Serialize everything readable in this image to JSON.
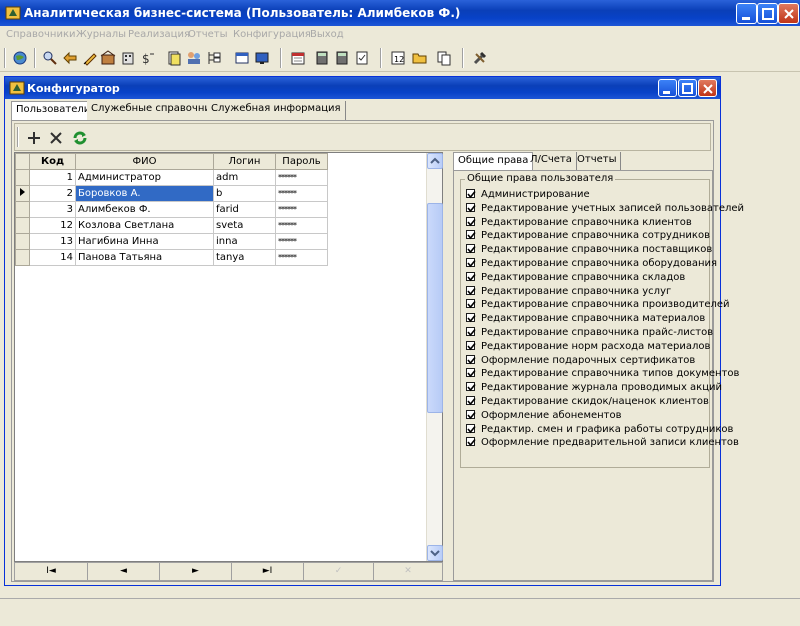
{
  "app": {
    "title": "Аналитическая бизнес-система  (Пользователь: Алимбеков Ф.)"
  },
  "menu": [
    "Справочники",
    "Журналы",
    "Реализация",
    "Отчеты",
    "Конфигурация",
    "Выход"
  ],
  "child": {
    "title": "Конфигуратор",
    "tabs": [
      "Пользователи",
      "Служебные справочники",
      "Служебная информация"
    ],
    "active_tab": "Пользователи"
  },
  "grid": {
    "columns": [
      "Код",
      "ФИО",
      "Логин",
      "Пароль"
    ],
    "rows": [
      {
        "code": "1",
        "fio": "Администратор",
        "login": "adm",
        "password": "******"
      },
      {
        "code": "2",
        "fio": "Боровков А.",
        "login": "b",
        "password": "******"
      },
      {
        "code": "3",
        "fio": "Алимбеков Ф.",
        "login": "farid",
        "password": "******"
      },
      {
        "code": "12",
        "fio": "Козлова Светлана",
        "login": "sveta",
        "password": "******"
      },
      {
        "code": "13",
        "fio": "Нагибина Инна",
        "login": "inna",
        "password": "******"
      },
      {
        "code": "14",
        "fio": "Панова Татьяна",
        "login": "tanya",
        "password": "******"
      }
    ],
    "selected_row": 1
  },
  "navigator": {
    "first": "I◄",
    "prev": "◄",
    "next": "►",
    "last": "►I",
    "post": "✓",
    "cancel": "✕"
  },
  "rights": {
    "tabs": [
      "Общие права",
      "Л/Счета",
      "Отчеты"
    ],
    "group_title": "Общие права пользователя",
    "items": [
      "Администрирование",
      "Редактирование учетных записей пользователей",
      "Редактирование справочника клиентов",
      "Редактирование справочника сотрудников",
      "Редактирование справочника поставщиков",
      "Редактирование справочника оборудования",
      "Редактирование справочника складов",
      "Редактирование справочника услуг",
      "Редактирование справочника производителей",
      "Редактирование справочника материалов",
      "Редактирование справочника прайс-листов",
      "Редактирование норм расхода материалов",
      "Оформление подарочных сертификатов",
      "Редактирование справочника типов документов",
      "Редактирование журнала  проводимых акций",
      "Редактирование скидок/наценок клиентов",
      "Оформление абонементов",
      "Редактир. смен и графика работы сотрудников",
      "Оформление предварительной записи клиентов"
    ]
  },
  "colors": {
    "titlebar": "#0a3fb8",
    "selection": "#316ac5",
    "face": "#ece9d8"
  }
}
